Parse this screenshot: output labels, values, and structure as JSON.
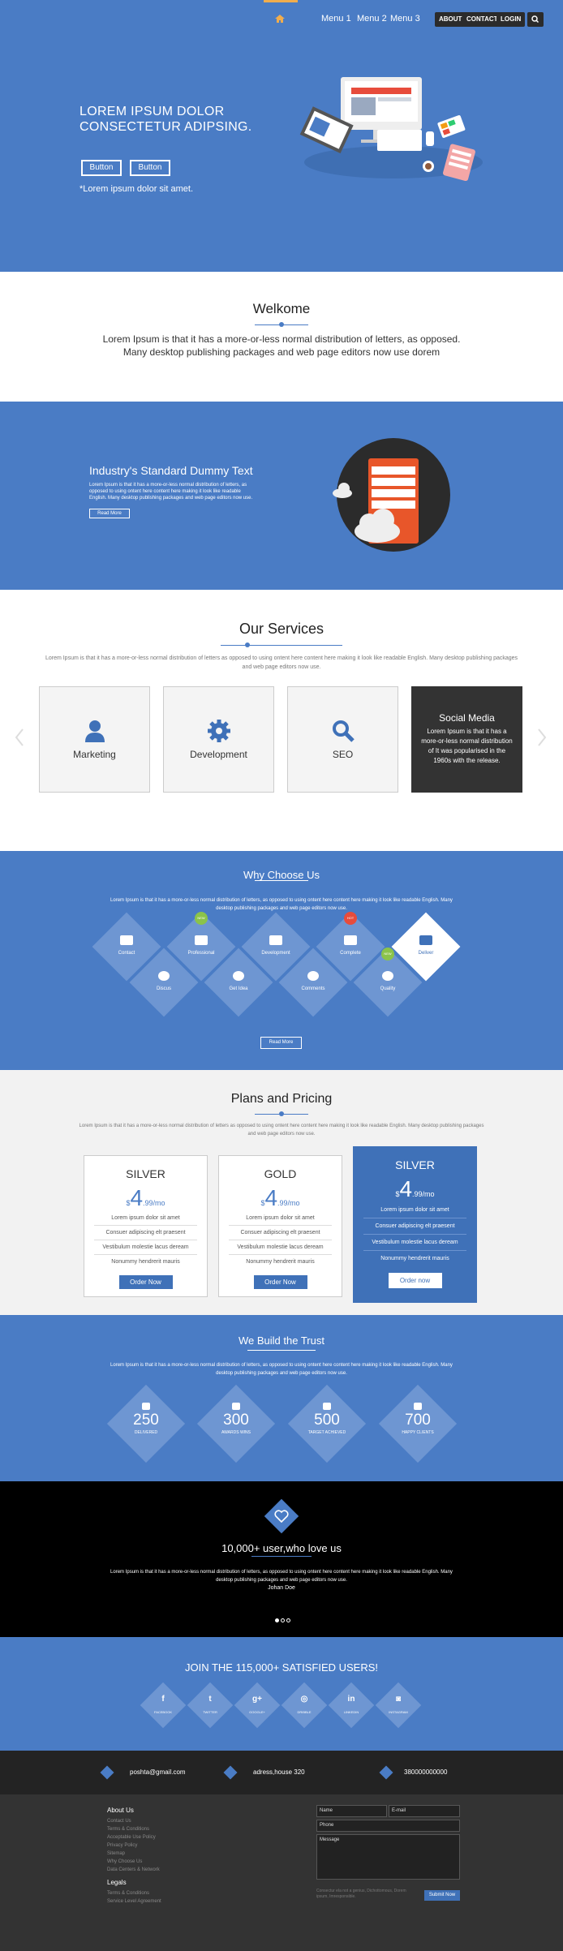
{
  "nav": {
    "menu1": "Menu 1",
    "menu2": "Menu 2",
    "menu3": "Menu 3",
    "about": "ABOUT",
    "contact": "CONTACT",
    "login": "LOGIN"
  },
  "hero": {
    "title": "LOREM IPSUM DOLOR CONSECTETUR ADIPSING.",
    "btn1": "Button",
    "btn2": "Button",
    "note": "*Lorem ipsum dolor sit amet."
  },
  "welcome": {
    "title": "Welkome",
    "text": "Lorem Ipsum is that it has a more-or-less normal distribution of letters, as opposed. Many desktop publishing packages and web page editors now use dorem"
  },
  "dummy": {
    "title": "Industry's Standard Dummy Text",
    "text": "Lorem Ipsum is that it has a more-or-less normal distribution of letters, as opposed to using ontent here content here making it look like readable English. Many desktop publishing packages and web page editors now use.",
    "btn": "Read More"
  },
  "services": {
    "title": "Our Services",
    "text": "Lorem Ipsum is that it has a more-or-less normal distribution of letters as opposed to using ontent here content here making it look like readable English. Many desktop publishing packages and web page editors now use.",
    "cards": [
      "Marketing",
      "Development",
      "SEO"
    ],
    "social_title": "Social Media",
    "social_text": "Lorem Ipsum is that it has a more-or-less normal distribution of It was popularised in the 1960s with the release."
  },
  "why": {
    "title": "Why Choose Us",
    "text": "Lorem Ipsum is that it has a more-or-less normal distribution of letters, as opposed to using ontent here content here making it look like readable English. Many desktop publishing packages and web page editors now use.",
    "top": [
      "Contact",
      "Professional",
      "Development",
      "Complete",
      "Deliver"
    ],
    "bottom": [
      "Discus",
      "Get Idea",
      "Comments",
      "Quality"
    ],
    "badges": [
      "NEW",
      "HOT",
      "NEW"
    ],
    "btn": "Read More"
  },
  "plans": {
    "title": "Plans and Pricing",
    "text": "Lorem Ipsum is that it has a more-or-less normal distribution of letters as opposed to using ontent here content here making it look like readable English. Many desktop publishing packages and web page editors now use.",
    "items": [
      {
        "name": "SILVER",
        "price": "4",
        "cents": ".99",
        "per": "/mo"
      },
      {
        "name": "GOLD",
        "price": "4",
        "cents": ".99",
        "per": "/mo"
      },
      {
        "name": "SILVER",
        "price": "4",
        "cents": ".99",
        "per": "/mo"
      }
    ],
    "features": [
      "Lorem ipsum dolor sit amet",
      "Consuer adipiscing elt praesent",
      "Vestibulum molestie lacus deream",
      "Nonummy hendrerit mauris"
    ],
    "order": "Order Now",
    "order_alt": "Order now"
  },
  "trust": {
    "title": "We Build the Trust",
    "text": "Lorem Ipsum is that it has a more-or-less normal distribution of letters, as opposed to using ontent here content here making it look like readable English. Many desktop publishing packages and web page editors now use.",
    "stats": [
      {
        "num": "250",
        "label": "DELIVERED"
      },
      {
        "num": "300",
        "label": "AWARDS WINS"
      },
      {
        "num": "500",
        "label": "TARGET ACHIEVED"
      },
      {
        "num": "700",
        "label": "HAPPY CLIENTS"
      }
    ]
  },
  "loved": {
    "title": "10,000+ user,who love us",
    "text": "Lorem Ipsum is that it has a more-or-less normal distribution of letters, as opposed to using ontent here content here making it look like readable English. Many desktop publishing packages and web page editors now use.",
    "author": "Johan Doe"
  },
  "join": {
    "title": "JOIN THE 115,000+ SATISFIED USERS!",
    "social": [
      "FACEBOOK",
      "TWITTER",
      "GOOGLE+",
      "DRIBBLE",
      "LINKEDIN",
      "INSTAGRAM"
    ]
  },
  "contacts": {
    "email": "poshta@gmail.com",
    "address": "adress,house 320",
    "phone": "380000000000"
  },
  "footer": {
    "about": "About Us",
    "about_links": [
      "Contact Us",
      "Terms & Conditions",
      "Acceptable Use Policy",
      "Privacy Policy",
      "Sitemap",
      "Why Choose Us",
      "Data Centers & Network"
    ],
    "legals": "Legals",
    "legal_links": [
      "Terms & Conditions",
      "Service Level Agreement"
    ],
    "name_ph": "Name",
    "email_ph": "E-mail",
    "phone_ph": "Phone",
    "message_ph": "Message",
    "consent": "Consectur ela not a genius, Dichottomous, Dorem ipsum, Imresponsible.",
    "submit": "Submit Now"
  }
}
